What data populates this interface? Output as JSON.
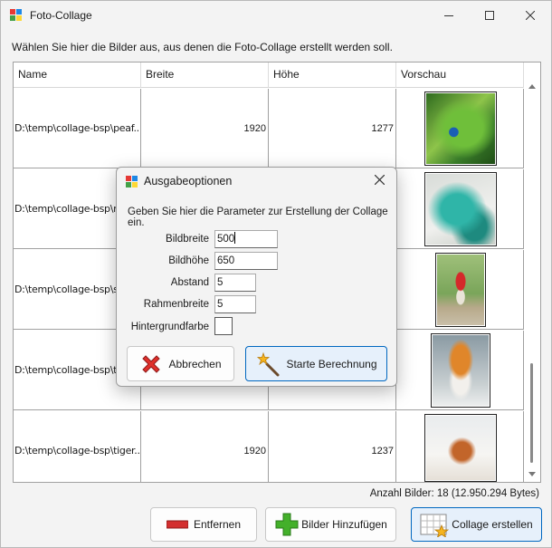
{
  "window": {
    "title": "Foto-Collage"
  },
  "instruction": "Wählen Sie hier die Bilder aus, aus denen die Foto-Collage erstellt werden soll.",
  "table": {
    "columns": [
      "Name",
      "Breite",
      "Höhe",
      "Vorschau"
    ],
    "rows": [
      {
        "name": "D:\\temp\\collage-bsp\\peaf...",
        "breite": "1920",
        "hoehe": "1277",
        "preview": "peacock"
      },
      {
        "name": "D:\\temp\\collage-bsp\\rep",
        "breite": "",
        "hoehe": "",
        "preview": "lizard"
      },
      {
        "name": "D:\\temp\\collage-bsp\\soc",
        "breite": "",
        "hoehe": "",
        "preview": "child-in-red"
      },
      {
        "name": "D:\\temp\\collage-bsp\\tig",
        "breite": "",
        "hoehe": "",
        "preview": "tiger-sitting"
      },
      {
        "name": "D:\\temp\\collage-bsp\\tiger...",
        "breite": "1920",
        "hoehe": "1237",
        "preview": "tiger-snow"
      }
    ]
  },
  "status": {
    "count_text": "Anzahl Bilder: 18 (12.950.294 Bytes)"
  },
  "buttons": {
    "remove": "Entfernen",
    "add": "Bilder Hinzufügen",
    "create": "Collage erstellen"
  },
  "dialog": {
    "title": "Ausgabeoptionen",
    "description": "Geben Sie hier die Parameter zur Erstellung der Collage ein.",
    "fields": {
      "bildbreite_label": "Bildbreite",
      "bildbreite_value": "500",
      "bildhoehe_label": "Bildhöhe",
      "bildhoehe_value": "650",
      "abstand_label": "Abstand",
      "abstand_value": "5",
      "rahmenbreite_label": "Rahmenbreite",
      "rahmenbreite_value": "5",
      "hintergrund_label": "Hintergrundfarbe",
      "hintergrund_color": "#ffffff"
    },
    "cancel_label": "Abbrechen",
    "start_label": "Starte Berechnung"
  },
  "colors": {
    "accent_border": "#0067c0",
    "primary_btn_bg": "#e6f0fb"
  }
}
